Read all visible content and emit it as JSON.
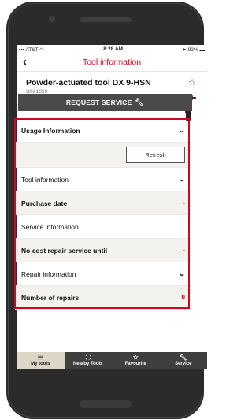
{
  "status_bar": {
    "carrier": "AT&T",
    "time": "8:28 AM",
    "battery": "92%"
  },
  "nav": {
    "title": "Tool information"
  },
  "tool": {
    "name": "Powder-actuated tool DX 9-HSN",
    "serial": "S/N:1059"
  },
  "actions": {
    "request_service": "REQUEST SERVICE"
  },
  "sections": {
    "usage": {
      "label": "Usage Information",
      "refresh": "Refresh"
    },
    "tool_info": {
      "label": "Tool information"
    },
    "purchase_date": {
      "label": "Purchase date",
      "value": "-"
    },
    "service_info": {
      "label": "Service information"
    },
    "no_cost": {
      "label": "No cost repair service until",
      "value": "-"
    },
    "repair_info": {
      "label": "Repair information"
    },
    "number_of_repairs": {
      "label": "Number of repairs",
      "value": "0"
    }
  },
  "tabs": [
    {
      "label": "My tools",
      "icon": "list-icon"
    },
    {
      "label": "Nearby Tools",
      "icon": "nearby-icon"
    },
    {
      "label": "Favourite",
      "icon": "star-icon"
    },
    {
      "label": "Service",
      "icon": "wrench-icon"
    }
  ],
  "colors": {
    "accent": "#d2051e",
    "tabbar": "#3f3f3f",
    "active_tab": "#dcd6c8"
  }
}
